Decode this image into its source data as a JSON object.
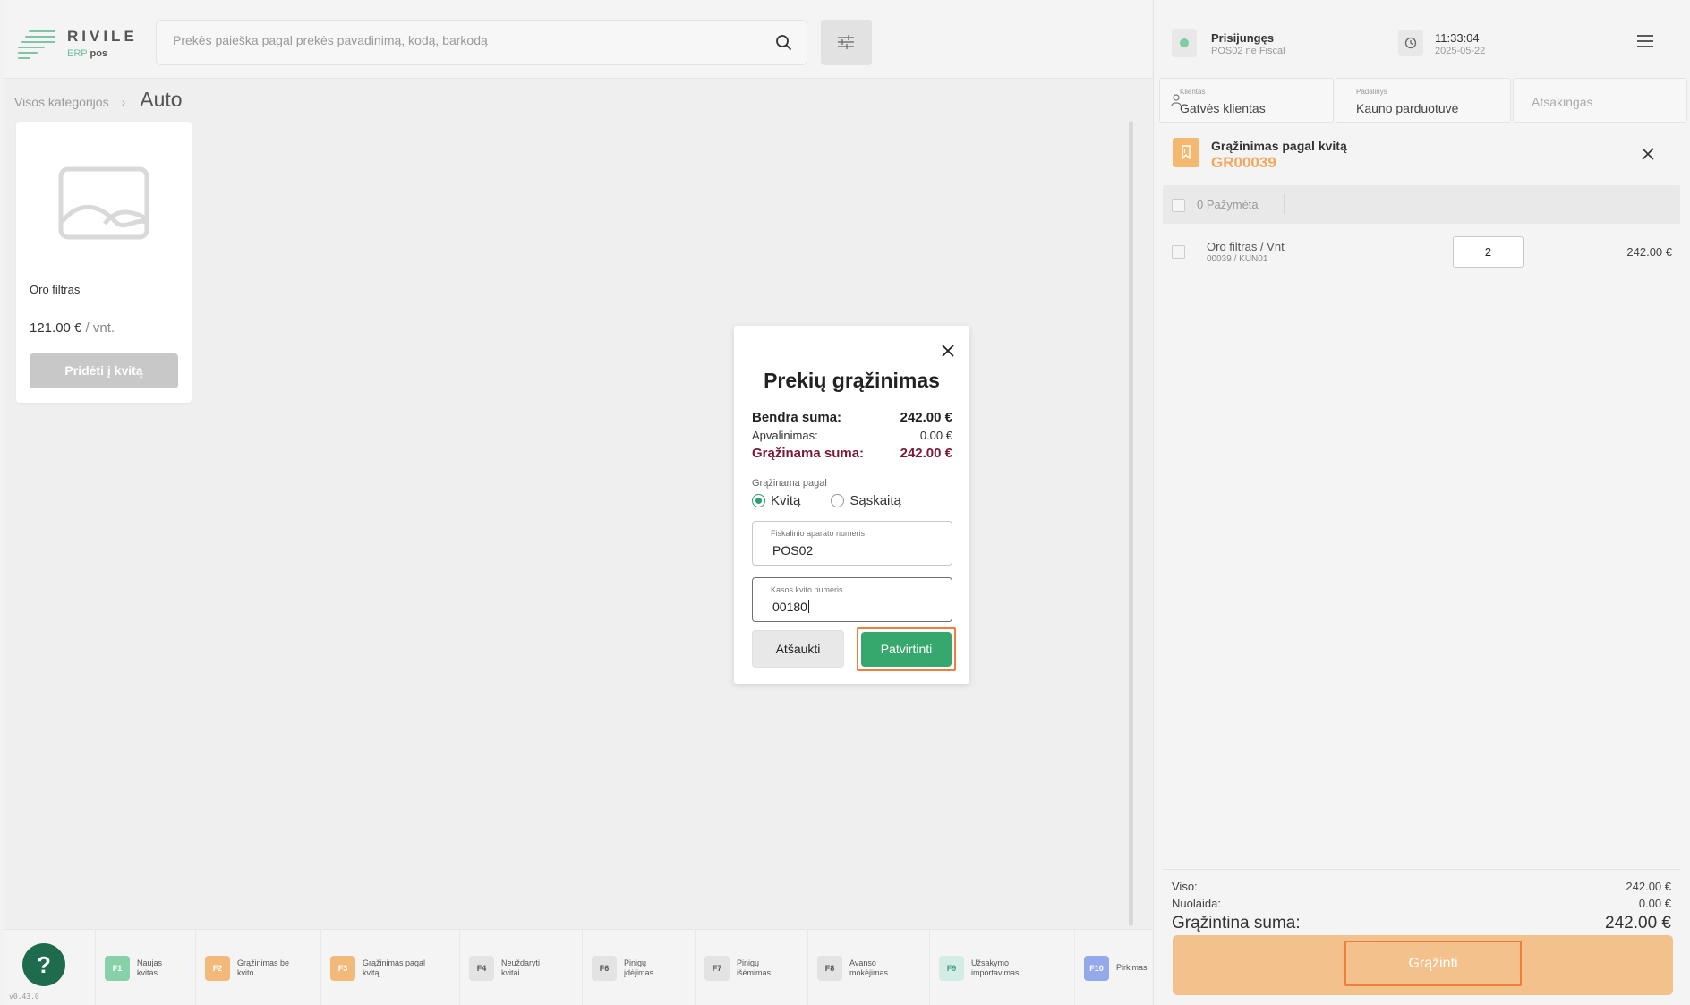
{
  "app": {
    "logo_name": "RIVILE",
    "logo_erp": "ERP",
    "logo_pos": "pos",
    "version": "v0.43.0"
  },
  "search": {
    "placeholder": "Prekės paieška pagal prekės pavadinimą, kodą, barkodą",
    "icon": "search-icon"
  },
  "breadcrumb": {
    "root": "Visos kategorijos",
    "separator": "›",
    "current": "Auto"
  },
  "products": [
    {
      "name": "Oro filtras",
      "price": "121.00 €",
      "unit": " / vnt.",
      "button": "Pridėti į kvitą"
    }
  ],
  "function_keys": [
    {
      "key": "F1",
      "label": "Naujas kvitas",
      "color": "#88d1a8"
    },
    {
      "key": "F2",
      "label": "Grąžinimas be kvito",
      "color": "#f3b97a"
    },
    {
      "key": "F3",
      "label": "Grąžinimas pagal kvitą",
      "color": "#f3b97a"
    },
    {
      "key": "F4",
      "label": "Neuždaryti kvitai",
      "color": "#e3e3e3"
    },
    {
      "key": "F6",
      "label": "Pinigų įdėjimas",
      "color": "#e3e3e3"
    },
    {
      "key": "F7",
      "label": "Pinigų išėmimas",
      "color": "#e3e3e3"
    },
    {
      "key": "F8",
      "label": "Avanso mokėjimas",
      "color": "#e3e3e3"
    },
    {
      "key": "F9",
      "label": "Užsakymo importavimas",
      "color": "#d3ece6"
    },
    {
      "key": "F10",
      "label": "Pirkimas",
      "color": "#93a9ea"
    }
  ],
  "help": {
    "icon": "question-icon",
    "symbol": "?"
  },
  "modal": {
    "title": "Prekių grąžinimas",
    "total_label": "Bendra suma:",
    "total_value": "242.00 €",
    "rounding_label": "Apvalinimas:",
    "rounding_value": "0.00 €",
    "return_label": "Grąžinama suma:",
    "return_value": "242.00 €",
    "return_by_label": "Grąžinama pagal",
    "option_receipt": "Kvitą",
    "option_invoice": "Sąskaitą",
    "selected_option": "Kvitą",
    "fiscal_label": "Fiskalinio aparato numeris",
    "fiscal_value": "POS02",
    "receipt_no_label": "Kasos kvito numeris",
    "receipt_no_value": "00180",
    "cancel": "Atšaukti",
    "confirm": "Patvirtinti",
    "accent_color": "#36a86d"
  },
  "status": {
    "title": "Prisijungęs",
    "subtitle": "POS02 ne Fiscal"
  },
  "clock": {
    "time": "11:33:04",
    "date": "2025-05-22"
  },
  "tabs": [
    {
      "label": "Klientas",
      "value": "Gatvės klientas"
    },
    {
      "label": "Padalinys",
      "value": "Kauno parduotuvė"
    },
    {
      "label": "",
      "value": "Atsakingas"
    }
  ],
  "return_doc": {
    "title": "Grąžinimas pagal kvitą",
    "number": "GR00039"
  },
  "selection": {
    "label": "0 Pažymėta"
  },
  "lines": [
    {
      "name": "Oro filtras / Vnt",
      "code": "00039 / KUN01",
      "qty": "2",
      "price": "242.00 €"
    }
  ],
  "totals": {
    "total_label": "Viso:",
    "total_value": "242.00 €",
    "discount_label": "Nuolaida:",
    "discount_value": "0.00 €",
    "return_label": "Grąžintina suma:",
    "return_value": "242.00 €"
  },
  "return_button": "Grąžinti"
}
